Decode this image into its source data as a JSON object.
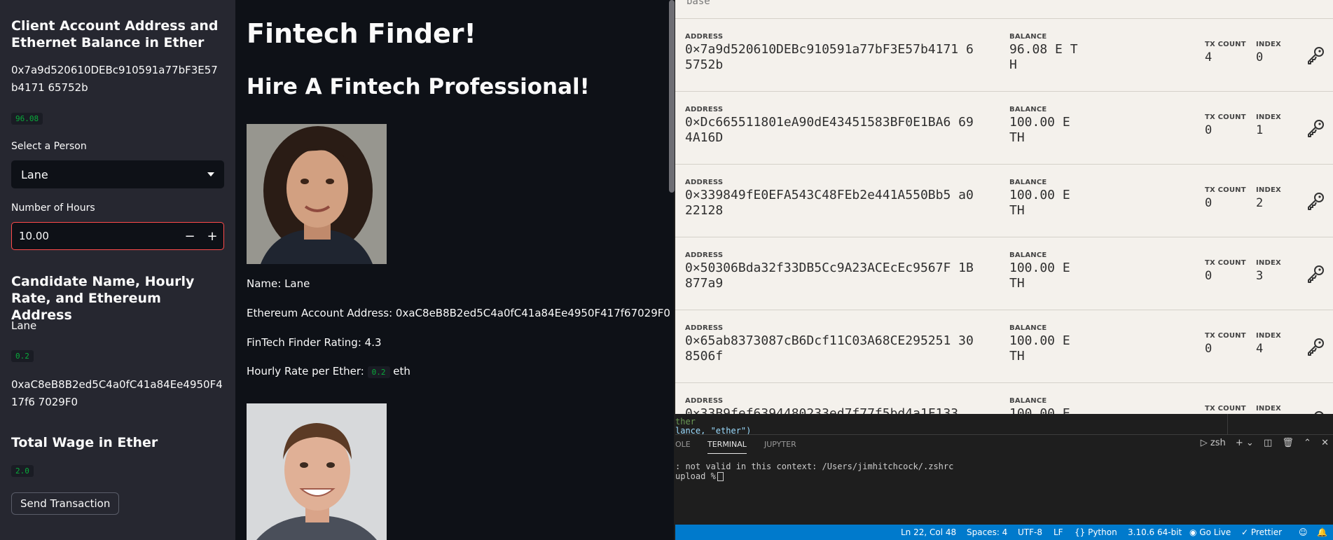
{
  "sidebar": {
    "header": "Client Account Address and Ethernet Balance in Ether",
    "client_address": "0x7a9d520610DEBc910591a77bF3E57b4171 65752b",
    "balance": "96.08",
    "select_label": "Select a Person",
    "selected_person": "Lane",
    "hours_label": "Number of Hours",
    "hours_value": "10.00",
    "minus": "−",
    "plus": "+",
    "candidate_header": "Candidate Name, Hourly Rate, and Ethereum Address",
    "candidate_name": "Lane",
    "candidate_rate": "0.2",
    "candidate_address": "0xaC8eB8B2ed5C4a0fC41a84Ee4950F417f6 7029F0",
    "total_header": "Total Wage in Ether",
    "total_value": "2.0",
    "send_button": "Send Transaction"
  },
  "main": {
    "title": "Fintech Finder!",
    "subtitle": "Hire A Fintech Professional!",
    "name_line": "Name: Lane",
    "address_line": "Ethereum Account Address: 0xaC8eB8B2ed5C4a0fC41a84Ee4950F417f67029F0",
    "rating_line": "FinTech Finder Rating: 4.3",
    "rate_prefix": "Hourly Rate per Ether:",
    "rate_value": "0.2",
    "rate_suffix": "eth"
  },
  "ganache": {
    "top_label": "base",
    "labels": {
      "address": "ADDRESS",
      "balance": "BALANCE",
      "tx_count": "TX COUNT",
      "index": "INDEX"
    },
    "accounts": [
      {
        "address": "0×7a9d520610DEBc910591a77bF3E57b4171 65752b",
        "balance": "96.08 E TH",
        "tx_count": "4",
        "index": "0"
      },
      {
        "address": "0×Dc665511801eA90dE43451583BF0E1BA6 694A16D",
        "balance": "100.00 E TH",
        "tx_count": "0",
        "index": "1"
      },
      {
        "address": "0×339849fE0EFA543C48FEb2e441A550Bb5 a022128",
        "balance": "100.00 E TH",
        "tx_count": "0",
        "index": "2"
      },
      {
        "address": "0×50306Bda32f33DB5Cc9A23ACEcEc9567F 1B877a9",
        "balance": "100.00 E TH",
        "tx_count": "0",
        "index": "3"
      },
      {
        "address": "0×65ab8373087cB6Dcf11C03A68CE295251 308506f",
        "balance": "100.00 E TH",
        "tx_count": "0",
        "index": "4"
      },
      {
        "address": "0×33B9fef6394480233ed7f77f5bd4a1F133",
        "balance": "100.00 E",
        "tx_count": "",
        "index": ""
      }
    ]
  },
  "vscode": {
    "code_line_1": "ther",
    "code_line_2": "lance, \"ether\")",
    "tabs": [
      "OLE",
      "TERMINAL",
      "JUPYTER"
    ],
    "active_tab": "TERMINAL",
    "shell": "zsh",
    "term_line_1": ": not valid in this context: /Users/jimhitchcock/.zshrc",
    "term_line_2": "upload  %",
    "status": {
      "position": "Ln 22, Col 48",
      "spaces": "Spaces: 4",
      "encoding": "UTF-8",
      "eol": "LF",
      "language": "Python",
      "interpreter": "3.10.6 64-bit",
      "go_live": "Go Live",
      "prettier": "Prettier"
    }
  },
  "colors": {
    "sidebar_bg": "#262730",
    "main_bg": "#0e1117",
    "accent_red": "#ff4b4b",
    "code_green": "#09ab3b",
    "statusbar": "#007acc"
  }
}
